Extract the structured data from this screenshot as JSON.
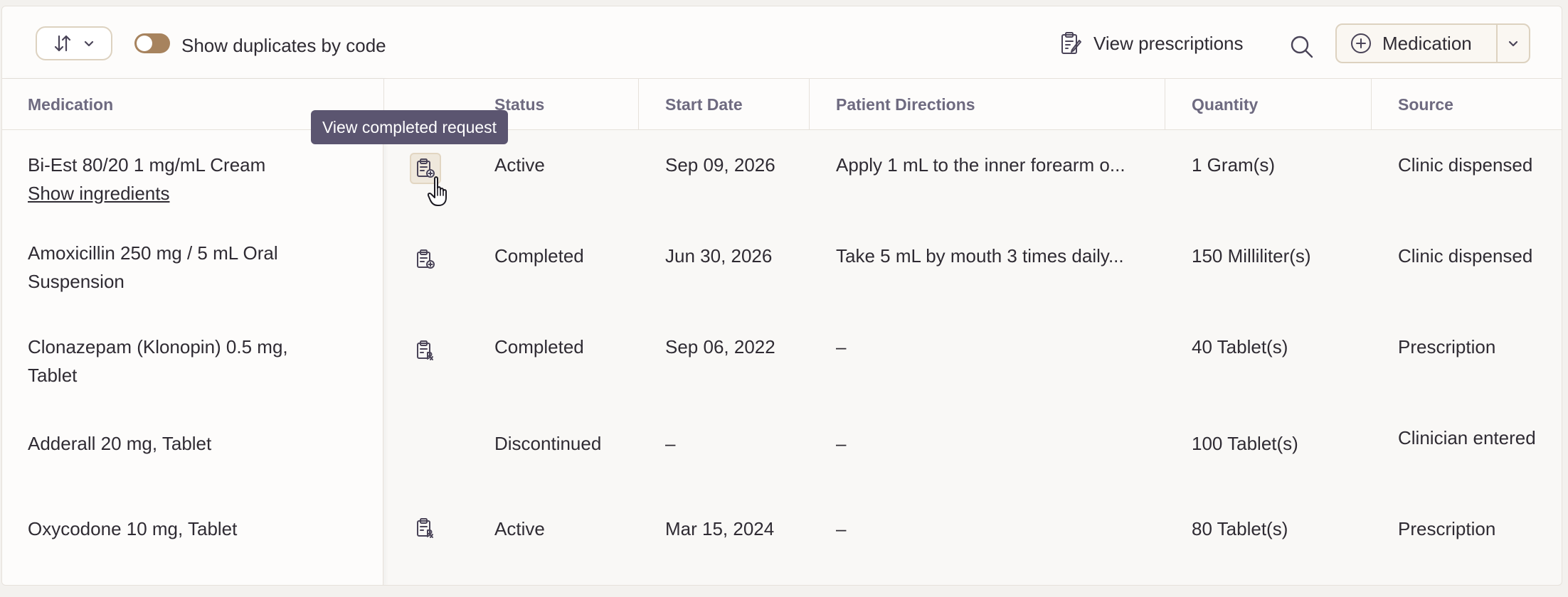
{
  "toolbar": {
    "sort_icon": "sort-arrows-icon",
    "toggle_label": "Show duplicates by code",
    "toggle_on": true,
    "view_prescriptions_label": "View prescriptions",
    "add_medication_label": "Medication"
  },
  "table": {
    "columns": [
      "Medication",
      "Status",
      "Start Date",
      "Patient Directions",
      "Quantity",
      "Source"
    ],
    "rows": [
      {
        "medication": "Bi-Est 80/20 1 mg/mL Cream",
        "link": "Show ingredients",
        "status": "Active",
        "start_date": "Sep 09, 2026",
        "directions": "Apply 1 mL to the inner forearm o...",
        "quantity": "1 Gram(s)",
        "source": "Clinic dispensed",
        "icon": "clipboard-plus-icon"
      },
      {
        "medication": "Amoxicillin 250 mg / 5 mL Oral",
        "medication_line2": "Suspension",
        "status": "Completed",
        "start_date": "Jun 30, 2026",
        "directions": "Take 5 mL by mouth 3 times daily...",
        "quantity": "150 Milliliter(s)",
        "source": "Clinic dispensed",
        "icon": "clipboard-plus-icon"
      },
      {
        "medication": "Clonazepam (Klonopin) 0.5 mg,",
        "medication_line2": "Tablet",
        "status": "Completed",
        "start_date": "Sep 06, 2022",
        "directions": "–",
        "quantity": "40 Tablet(s)",
        "source": "Prescription",
        "icon": "clipboard-rx-icon"
      },
      {
        "medication": "Adderall 20 mg, Tablet",
        "status": "Discontinued",
        "start_date": "–",
        "directions": "–",
        "quantity": "100 Tablet(s)",
        "source": "Clinician entered"
      },
      {
        "medication": "Oxycodone 10 mg, Tablet",
        "status": "Active",
        "start_date": "Mar 15, 2024",
        "directions": "–",
        "quantity": "80 Tablet(s)",
        "source": "Prescription",
        "icon": "clipboard-rx-icon"
      }
    ]
  },
  "tooltip": {
    "text": "View completed request"
  },
  "colors": {
    "accent": "#a7835e",
    "tooltip_bg": "#5b5570",
    "header_text": "#6e6a80"
  }
}
